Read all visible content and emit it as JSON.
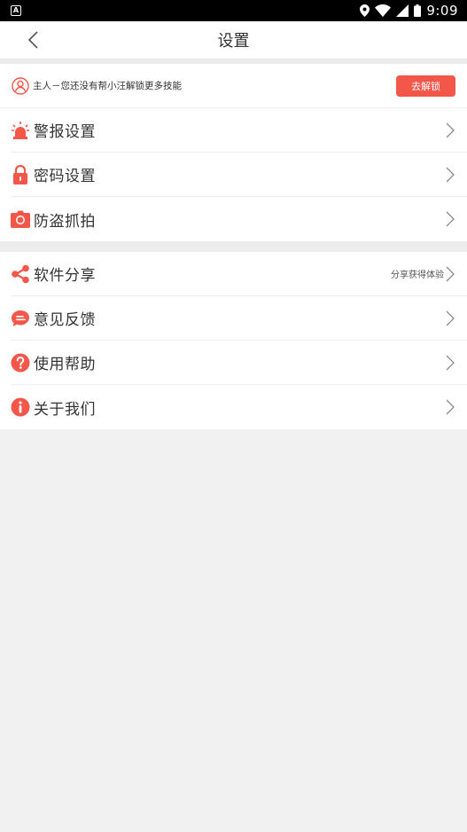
{
  "status_bar": {
    "app_badge": "A",
    "time": "9:09"
  },
  "header": {
    "title": "设置"
  },
  "notice": {
    "text": "主人－您还没有帮小汪解锁更多技能",
    "button_label": "去解锁"
  },
  "section1": {
    "items": [
      {
        "label": "警报设置",
        "icon": "alarm-light-icon"
      },
      {
        "label": "密码设置",
        "icon": "lock-icon"
      },
      {
        "label": "防盗抓拍",
        "icon": "camera-icon"
      }
    ]
  },
  "section2": {
    "items": [
      {
        "label": "软件分享",
        "icon": "share-icon",
        "hint": "分享获得体验"
      },
      {
        "label": "意见反馈",
        "icon": "chat-bubble-icon"
      },
      {
        "label": "使用帮助",
        "icon": "help-icon"
      },
      {
        "label": "关于我们",
        "icon": "info-icon"
      }
    ]
  },
  "colors": {
    "accent": "#f2574a",
    "text": "#333333",
    "background": "#f1f1f1"
  }
}
